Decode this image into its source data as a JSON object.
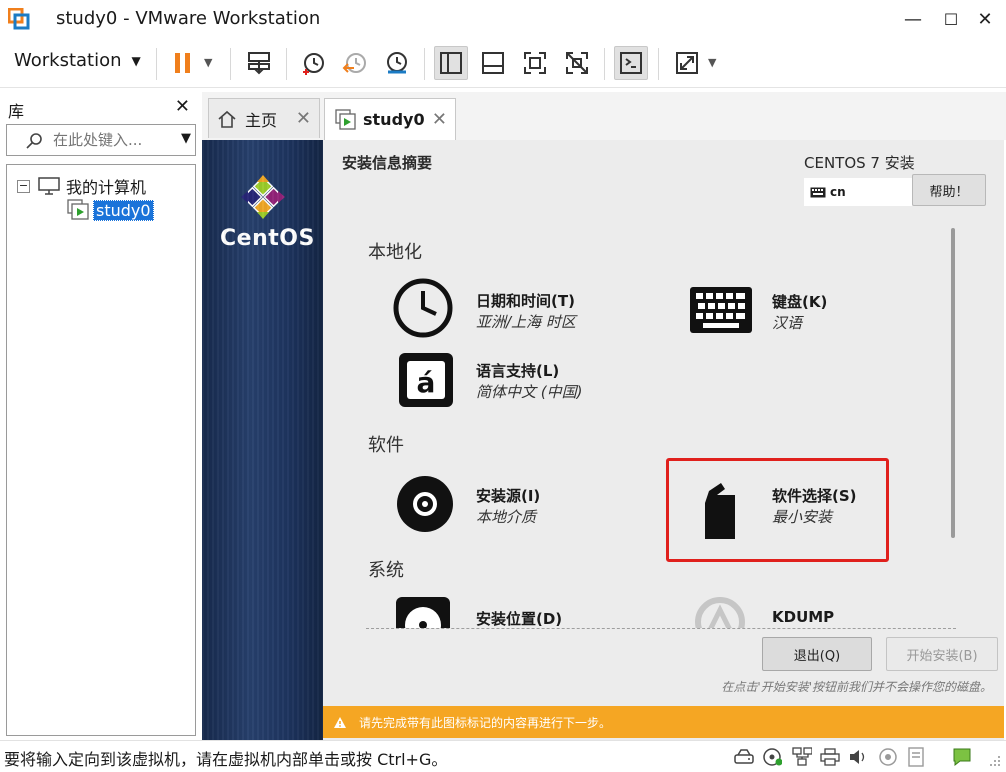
{
  "window": {
    "title": "study0 - VMware Workstation",
    "minimize": "—",
    "maximize": "☐",
    "close": "✕"
  },
  "toolbar": {
    "menu_label": "Workstation",
    "menu_caret": "▼",
    "pause_color": "#f07f1c"
  },
  "library": {
    "title": "库",
    "close": "✕",
    "search_placeholder": "在此处键入...",
    "search_caret": "▼",
    "tree": {
      "expander": "−",
      "root_label": "我的计算机",
      "vm_label": "study0"
    }
  },
  "tabs": [
    {
      "label": "主页",
      "close": "✕"
    },
    {
      "label": "study0",
      "close": "✕"
    }
  ],
  "installer": {
    "brand": "CentOS",
    "summary_title": "安装信息摘要",
    "product": "CENTOS 7 安装",
    "keyboard_layout": "cn",
    "help_button": "帮助！",
    "sections": {
      "localization": "本地化",
      "software": "软件",
      "system": "系统"
    },
    "spokes": {
      "datetime": {
        "name": "日期和时间(T)",
        "status": "亚洲/上海 时区"
      },
      "keyboard": {
        "name": "键盘(K)",
        "status": "汉语"
      },
      "language": {
        "name": "语言支持(L)",
        "status": "简体中文 (中国)"
      },
      "source": {
        "name": "安装源(I)",
        "status": "本地介质"
      },
      "software": {
        "name": "软件选择(S)",
        "status": "最小安装"
      },
      "destination": {
        "name": "安装位置(D)"
      },
      "kdump": {
        "name": "KDUMP"
      }
    },
    "quit_button": "退出(Q)",
    "begin_button": "开始安装(B)",
    "footer_note": "在点击'开始安装'按钮前我们并不会操作您的磁盘。",
    "warning": "请先完成带有此图标标记的内容再进行下一步。",
    "highlight_color": "#e0201c",
    "warning_color": "#f5a623"
  },
  "statusbar": {
    "text": "要将输入定向到该虚拟机，请在虚拟机内部单击或按 Ctrl+G。"
  }
}
